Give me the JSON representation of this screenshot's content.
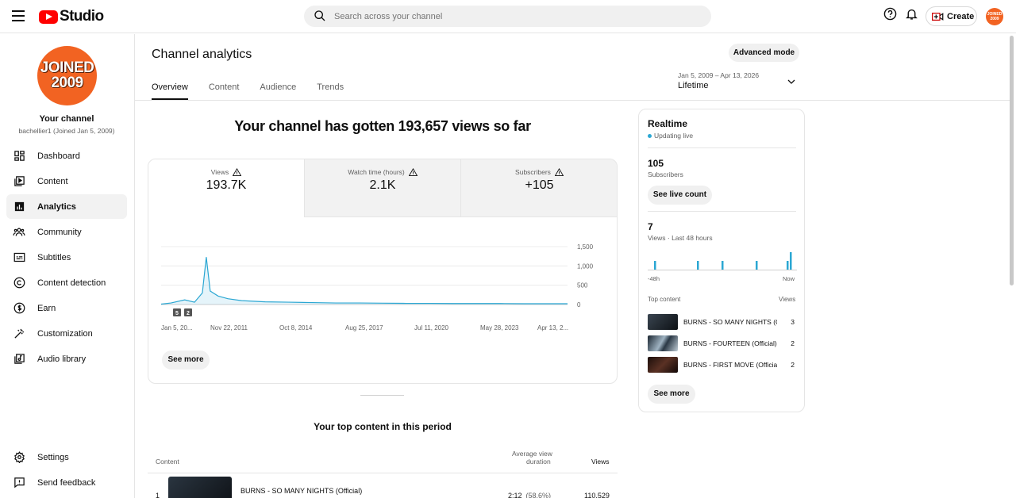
{
  "header": {
    "brand": "Studio",
    "search_placeholder": "Search across your channel",
    "create_label": "Create",
    "avatar_text": "JOINED 2009"
  },
  "sidebar": {
    "avatar_line1": "JOINED",
    "avatar_line2": "2009",
    "channel_title": "Your channel",
    "channel_sub": "bachellier1 (Joined Jan 5, 2009)",
    "items": [
      {
        "label": "Dashboard",
        "icon": "dashboard-icon"
      },
      {
        "label": "Content",
        "icon": "content-icon"
      },
      {
        "label": "Analytics",
        "icon": "analytics-icon",
        "active": true
      },
      {
        "label": "Community",
        "icon": "community-icon"
      },
      {
        "label": "Subtitles",
        "icon": "subtitles-icon"
      },
      {
        "label": "Content detection",
        "icon": "copyright-icon"
      },
      {
        "label": "Earn",
        "icon": "dollar-icon"
      },
      {
        "label": "Customization",
        "icon": "magic-wand-icon"
      },
      {
        "label": "Audio library",
        "icon": "audio-library-icon"
      }
    ],
    "bottom_items": [
      {
        "label": "Settings",
        "icon": "gear-icon"
      },
      {
        "label": "Send feedback",
        "icon": "feedback-icon"
      }
    ]
  },
  "main": {
    "title": "Channel analytics",
    "advanced_mode": "Advanced mode",
    "tabs": [
      "Overview",
      "Content",
      "Audience",
      "Trends"
    ],
    "date_range": "Jan 5, 2009 – Apr 13, 2026",
    "date_period": "Lifetime",
    "headline": "Your channel has gotten 193,657 views so far",
    "metrics": [
      {
        "label": "Views",
        "value": "193.7K"
      },
      {
        "label": "Watch time (hours)",
        "value": "2.1K"
      },
      {
        "label": "Subscribers",
        "value": "+105"
      }
    ],
    "see_more": "See more",
    "top_content_title": "Your top content in this period",
    "table": {
      "col_content": "Content",
      "col_avd_line1": "Average view",
      "col_avd_line2": "duration",
      "col_views": "Views",
      "rows": [
        {
          "rank": "1",
          "title": "BURNS - SO MANY NIGHTS (Official)",
          "avd": "2:12",
          "avd_pct": "(58.6%)",
          "views": "110,529"
        }
      ]
    }
  },
  "chart_data": {
    "type": "line",
    "title": "",
    "xlabel": "",
    "ylabel": "",
    "x_tick_labels": [
      "Jan 5, 20...",
      "Nov 22, 2011",
      "Oct 8, 2014",
      "Aug 25, 2017",
      "Jul 11, 2020",
      "May 28, 2023",
      "Apr 13, 2..."
    ],
    "y_tick_labels": [
      "1,500",
      "1,000",
      "500",
      "0"
    ],
    "ylim": [
      0,
      1500
    ],
    "markers": [
      "5",
      "2"
    ],
    "series": [
      {
        "color": "#2ba7d3",
        "x": [
          "2009-01",
          "2009-06",
          "2010-01",
          "2010-06",
          "2010-10",
          "2010-12",
          "2011-02",
          "2011-06",
          "2011-11",
          "2012-06",
          "2013-06",
          "2014-06",
          "2015-06",
          "2016-06",
          "2017-06",
          "2018-06",
          "2019-06",
          "2020-06",
          "2021-06",
          "2022-06",
          "2023-06",
          "2024-06",
          "2025-06",
          "2026-04"
        ],
        "values": [
          10,
          40,
          120,
          60,
          300,
          1230,
          350,
          220,
          150,
          100,
          70,
          60,
          50,
          40,
          40,
          35,
          30,
          30,
          25,
          25,
          25,
          20,
          20,
          20
        ]
      }
    ],
    "grid": true
  },
  "realtime": {
    "title": "Realtime",
    "status": "Updating live",
    "subs_value": "105",
    "subs_label": "Subscribers",
    "live_count_btn": "See live count",
    "views_value": "7",
    "views_label": "Views · Last 48 hours",
    "axis_start": "-48h",
    "axis_end": "Now",
    "bars": [
      1,
      1,
      1,
      1,
      1,
      2
    ],
    "top_content_label": "Top content",
    "views_col": "Views",
    "items": [
      {
        "title": "BURNS - SO MANY NIGHTS (Official)",
        "views": "3"
      },
      {
        "title": "BURNS - FOURTEEN (Official)",
        "views": "2"
      },
      {
        "title": "BURNS - FIRST MOVE (Official)",
        "views": "2"
      }
    ],
    "see_more": "See more"
  }
}
